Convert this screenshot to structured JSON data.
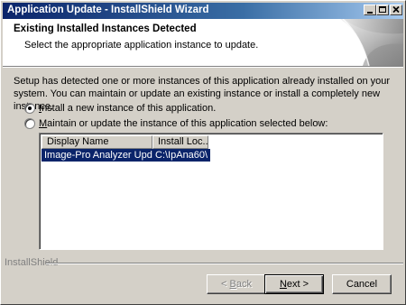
{
  "window": {
    "title": "Application Update - InstallShield Wizard"
  },
  "header": {
    "title": "Existing Installed Instances Detected",
    "subtitle": "Select the appropriate application instance to update."
  },
  "description": "Setup has detected one or more instances of this application already installed on your system. You can maintain or update an existing instance or install a completely new instance.",
  "options": [
    {
      "accel": "I",
      "rest": "nstall a new instance of this application.",
      "checked": true
    },
    {
      "accel": "M",
      "rest": "aintain or update the instance of this application selected below:",
      "checked": false
    }
  ],
  "list": {
    "columns": [
      "Display Name",
      "Install Loc..."
    ],
    "rows": [
      {
        "name": "Image-Pro Analyzer Update",
        "location": "C:\\IpAna60\\",
        "selected": true
      }
    ]
  },
  "footer": {
    "brand": "InstallShield"
  },
  "buttons": {
    "back": {
      "accel": "B",
      "rest": "ack",
      "prefix": "< "
    },
    "next": {
      "accel": "N",
      "rest": "ext >"
    },
    "cancel": "Cancel"
  },
  "titlebar_buttons": [
    "minimize-icon",
    "maximize-icon",
    "close-icon"
  ]
}
